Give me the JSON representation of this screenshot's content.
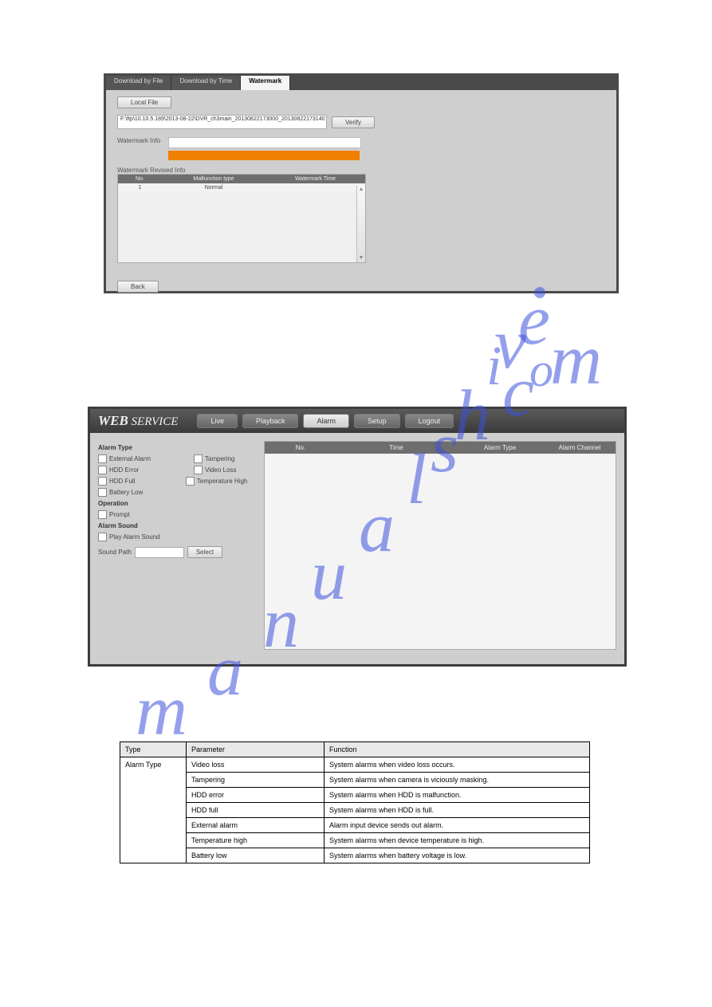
{
  "watermark_text": "manualshive.com",
  "shot1": {
    "tabs": [
      "Download by File",
      "Download by Time",
      "Watermark"
    ],
    "active_tab": 2,
    "local_file_btn": "Local File",
    "file_path": "F:\\ftp\\10.10.5.189\\2013-08-22\\DVR_ch3main_20130822173000_20130822173140",
    "verify_btn": "Verify",
    "watermark_info_label": "Watermark Info",
    "watermark_revised_label": "Watermark Revised Info",
    "grid_headers": {
      "no": "No.",
      "mal": "Malfunction type",
      "wt": "Watermark Time"
    },
    "grid_rows": [
      {
        "no": "1",
        "mal": "Normal",
        "wt": ""
      }
    ],
    "back_btn": "Back"
  },
  "shot2": {
    "logo": {
      "bold": "WEB",
      "rest": " SERVICE"
    },
    "nav": [
      "Live",
      "Playback",
      "Alarm",
      "Setup",
      "Logout"
    ],
    "nav_active": 2,
    "sections": {
      "alarm_type": "Alarm Type",
      "operation": "Operation",
      "alarm_sound": "Alarm Sound"
    },
    "checks": {
      "external_alarm": "External Alarm",
      "tampering": "Tampering",
      "hdd_error": "HDD Error",
      "video_loss": "Video Loss",
      "hdd_full": "HDD Full",
      "temperature_high": "Temperature High",
      "battery_low": "Battery Low",
      "prompt": "Prompt",
      "play_alarm_sound": "Play Alarm Sound"
    },
    "sound_path_label": "Sound Path",
    "select_btn": "Select",
    "right_headers": {
      "no": "No.",
      "time": "Time",
      "type": "Alarm Type",
      "channel": "Alarm Channel"
    }
  },
  "table": {
    "headers": {
      "type": "Type",
      "parameter": "Parameter",
      "function": "Function"
    },
    "rows": [
      {
        "type_rowspan": 7,
        "type": "Alarm Type",
        "param": "Video loss",
        "func": "System alarms when video loss occurs."
      },
      {
        "param": "Tampering",
        "func": "System alarms when camera is viciously masking."
      },
      {
        "param": "HDD error",
        "func": "System alarms when HDD is malfunction."
      },
      {
        "param": "HDD full",
        "func": "System alarms when HDD is full."
      },
      {
        "param": "External alarm",
        "func": "Alarm input device sends out alarm."
      },
      {
        "param": "Temperature high",
        "func": "System alarms when device temperature is high."
      },
      {
        "param": "Battery low",
        "func": "System alarms when battery voltage is low."
      }
    ]
  }
}
